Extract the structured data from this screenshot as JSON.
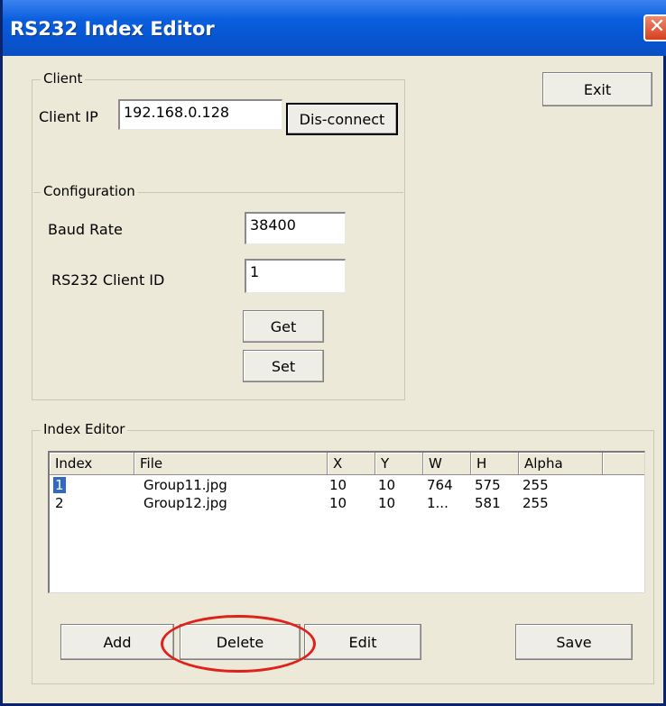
{
  "window": {
    "title": "RS232 Index Editor",
    "close_glyph": "✕"
  },
  "buttons": {
    "exit": "Exit"
  },
  "client": {
    "group_label": "Client",
    "ip_label": "Client IP",
    "ip_value": "192.168.0.128",
    "disconnect_label": "Dis-connect"
  },
  "configuration": {
    "group_label": "Configuration",
    "baud_label": "Baud Rate",
    "baud_value": "38400",
    "client_id_label": "RS232 Client ID",
    "client_id_value": "1",
    "get_label": "Get",
    "set_label": "Set"
  },
  "index_editor": {
    "group_label": "Index Editor",
    "columns": [
      "Index",
      "File",
      "X",
      "Y",
      "W",
      "H",
      "Alpha"
    ],
    "rows": [
      {
        "index": "1",
        "file": "Group11.jpg",
        "x": "10",
        "y": "10",
        "w": "764",
        "h": "575",
        "alpha": "255",
        "selected": true
      },
      {
        "index": "2",
        "file": "Group12.jpg",
        "x": "10",
        "y": "10",
        "w": "1...",
        "h": "581",
        "alpha": "255",
        "selected": false
      }
    ],
    "add_label": "Add",
    "delete_label": "Delete",
    "edit_label": "Edit",
    "save_label": "Save"
  },
  "annotation": {
    "color": "#e0201a",
    "target": "delete-button"
  },
  "colors": {
    "titlebar": "#0a5fde",
    "window_bg": "#ece9d8",
    "selection": "#316ac5"
  }
}
